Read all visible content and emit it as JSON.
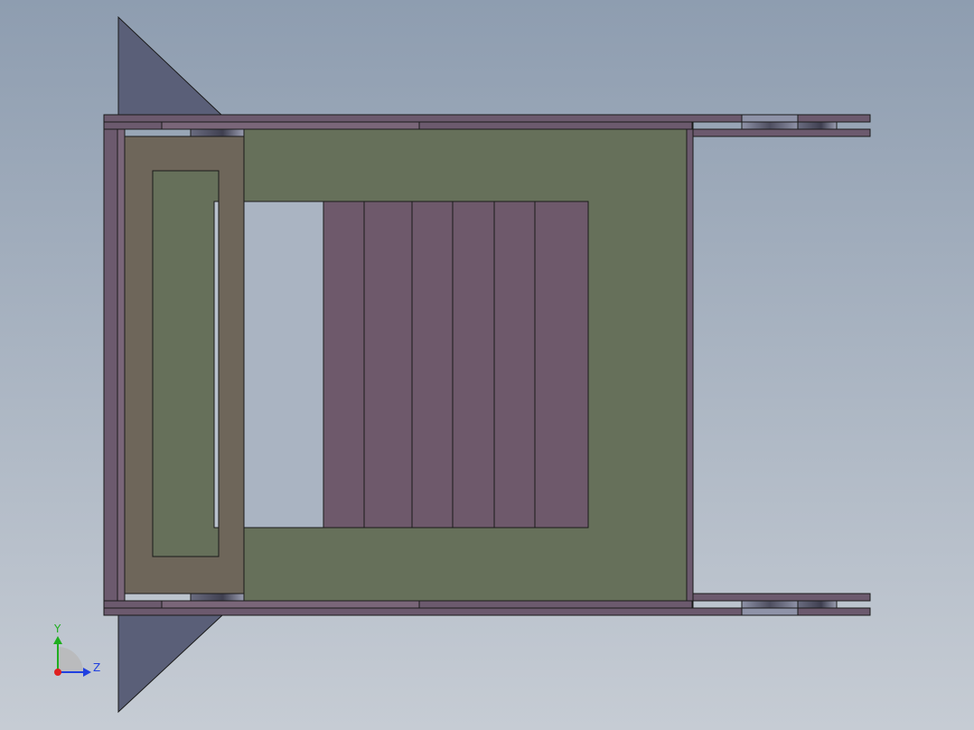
{
  "viewport": {
    "background_top": "#8e9db0",
    "background_bottom": "#c6ccd4"
  },
  "colors": {
    "outline": "#1a1a1a",
    "frame_purple": "#6c5a6e",
    "frame_purple_light": "#7a6679",
    "panel_green": "#66705a",
    "inset_brown": "#6e665a",
    "slat_purple": "#6e596b",
    "gusset_slate": "#5a5f78",
    "hinge_dark": "#4e4e60",
    "hinge_light": "#8f93a8",
    "axis_x": "#e02020",
    "axis_y": "#1fae1f",
    "axis_z": "#2040e0",
    "triad_arc": "#b8b8b8"
  },
  "model": {
    "slat_count": 6
  },
  "triad": {
    "y_label": "Y",
    "z_label": "Z",
    "icon": "coordinate-triad-icon"
  }
}
